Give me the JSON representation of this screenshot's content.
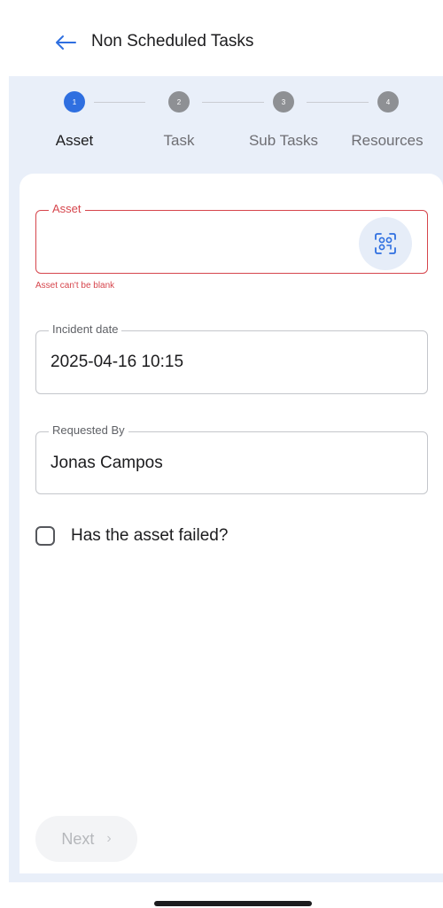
{
  "header": {
    "back_icon": "arrow-left-icon",
    "title": "Non Scheduled Tasks"
  },
  "stepper": {
    "steps": [
      {
        "number": "1",
        "label": "Asset",
        "state": "active"
      },
      {
        "number": "2",
        "label": "Task",
        "state": "inactive"
      },
      {
        "number": "3",
        "label": "Sub Tasks",
        "state": "inactive"
      },
      {
        "number": "4",
        "label": "Resources",
        "state": "inactive"
      }
    ],
    "active_color": "#2f6fe0"
  },
  "form": {
    "asset": {
      "label": "Asset",
      "value": "",
      "error": "Asset can't be blank",
      "dropdown_icon": "chevron-down-icon",
      "scan_icon": "scan-qr-icon"
    },
    "incident_date": {
      "label": "Incident date",
      "value": "2025-04-16 10:15"
    },
    "requested_by": {
      "label": "Requested By",
      "value": "Jonas Campos"
    },
    "asset_failed": {
      "label": "Has the asset failed?",
      "checked": false
    }
  },
  "footer": {
    "next_label": "Next",
    "next_icon": "chevron-right-icon",
    "next_enabled": false
  },
  "colors": {
    "error": "#d6454c",
    "stepper_background": "#e9eff9"
  }
}
